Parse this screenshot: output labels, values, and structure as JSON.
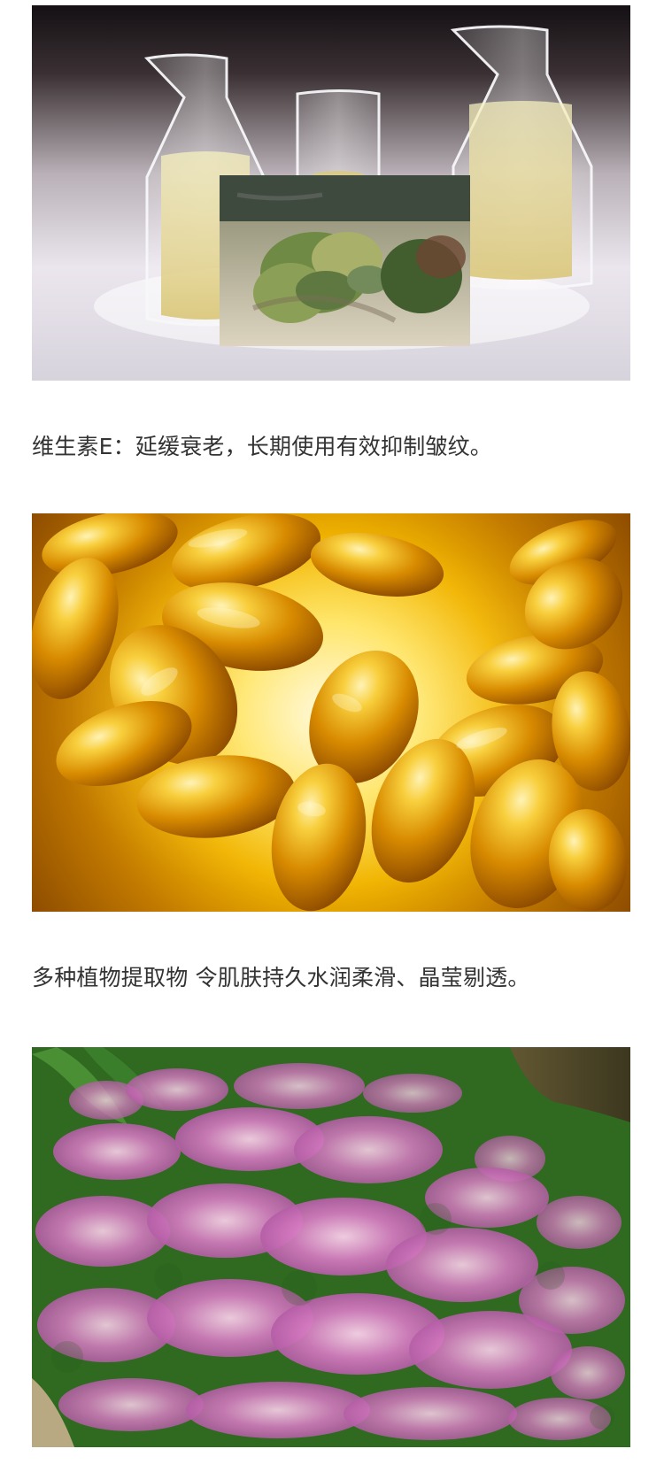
{
  "captions": {
    "vitamin_e": "维生素E：延缓衰老，长期使用有效抑制皱纹。",
    "plant_extract": "多种植物提取物 令肌肤持久水润柔滑、晶莹剔透。"
  },
  "colors": {
    "text": "#333333",
    "background": "#ffffff"
  }
}
